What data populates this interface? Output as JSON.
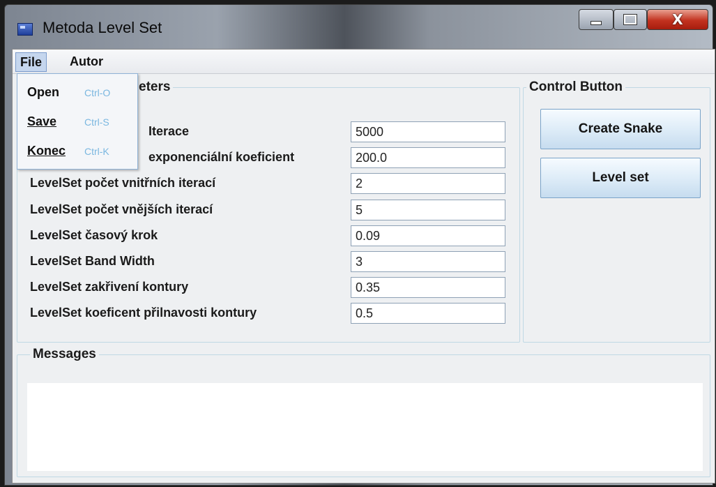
{
  "window": {
    "title": "Metoda Level Set",
    "close_glyph": "X"
  },
  "menubar": {
    "file": "File",
    "autor": "Autor"
  },
  "file_menu": {
    "items": [
      {
        "label": "Open",
        "shortcut": "Ctrl-O"
      },
      {
        "label": "Save",
        "shortcut": "Ctrl-S"
      },
      {
        "label": "Konec",
        "shortcut": "Ctrl-K"
      }
    ]
  },
  "params": {
    "legend": "eters",
    "rows": [
      {
        "label": "Iterace",
        "value": "5000"
      },
      {
        "label": "exponenciální koeficient",
        "value": "200.0"
      },
      {
        "label": "LevelSet počet vnitřních iterací",
        "value": "2"
      },
      {
        "label": "LevelSet počet vnějších iterací",
        "value": "5"
      },
      {
        "label": "LevelSet časový krok",
        "value": "0.09"
      },
      {
        "label": "LevelSet Band Width",
        "value": "3"
      },
      {
        "label": "LevelSet zakřivení kontury",
        "value": "0.35"
      },
      {
        "label": "LevelSet koeficent přilnavosti kontury",
        "value": "0.5"
      }
    ]
  },
  "control": {
    "legend": "Control Button",
    "create_snake": "Create Snake",
    "level_set": "Level set"
  },
  "messages": {
    "legend": "Messages",
    "content": ""
  }
}
